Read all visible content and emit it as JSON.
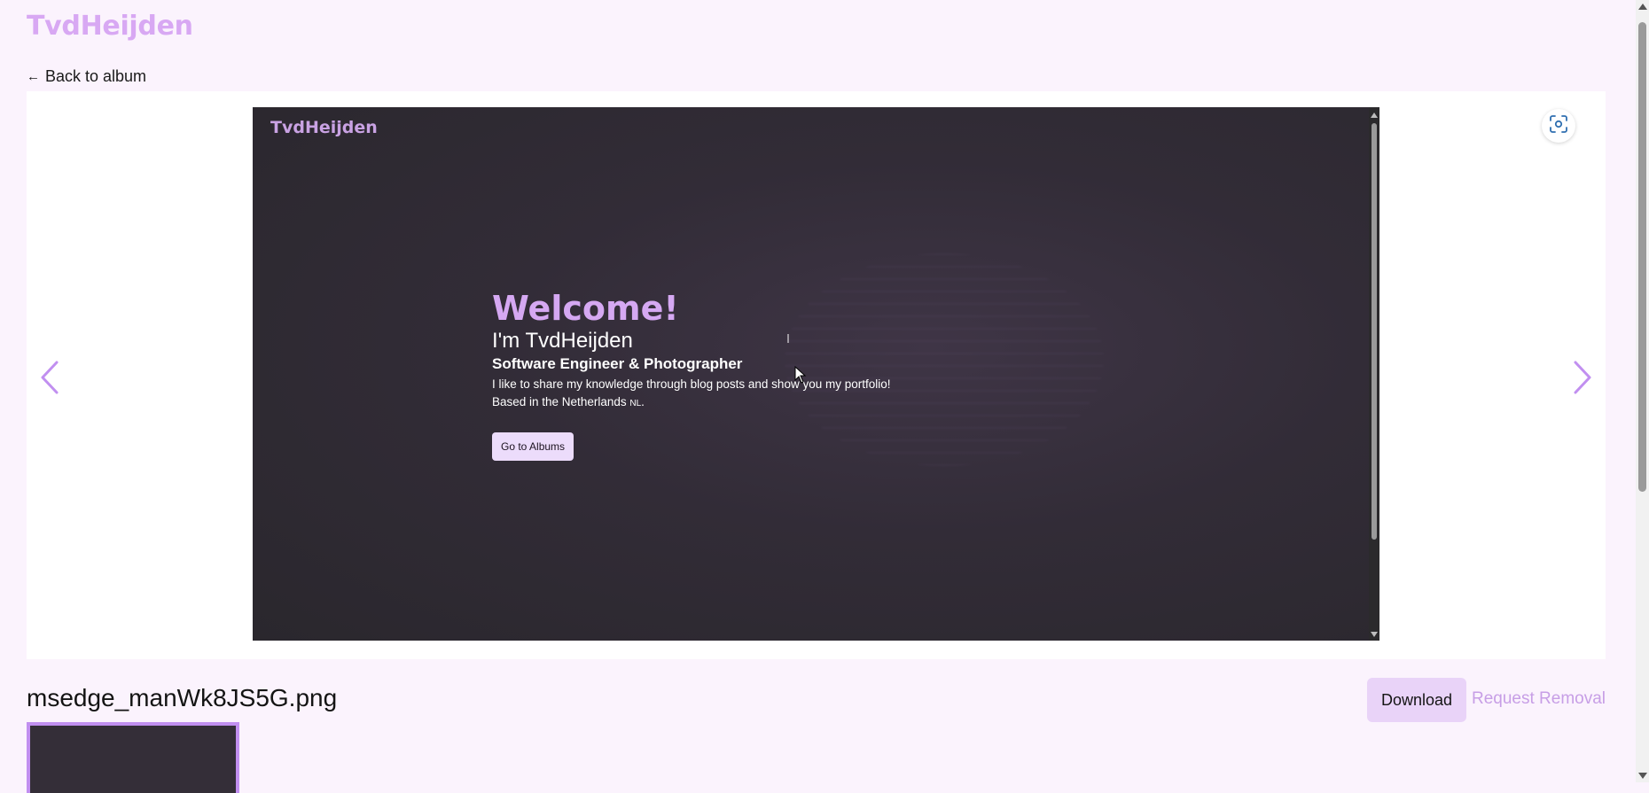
{
  "header": {
    "brand": "TvdHeijden",
    "back_label": "Back to album"
  },
  "viewer": {
    "prev_icon": "chevron-left-icon",
    "next_icon": "chevron-right-icon",
    "fullscreen_icon": "focus-frame-icon",
    "screenshot": {
      "brand": "TvdHeijden",
      "welcome": "Welcome!",
      "name": "I'm TvdHeijden",
      "role": "Software Engineer & Photographer",
      "description": "I like to share my knowledge through blog posts and show you my portfolio!",
      "location": "Based in the Netherlands",
      "country_code": "NL",
      "button_label": "Go to Albums"
    }
  },
  "photo": {
    "filename": "msedge_manWk8JS5G.png",
    "download_label": "Download",
    "removal_label": "Request Removal"
  },
  "colors": {
    "accent": "#d8a8f3",
    "download_bg": "#e9d3f8",
    "page_bg": "#fbf3fd",
    "thumb_border": "#c18ff0"
  }
}
